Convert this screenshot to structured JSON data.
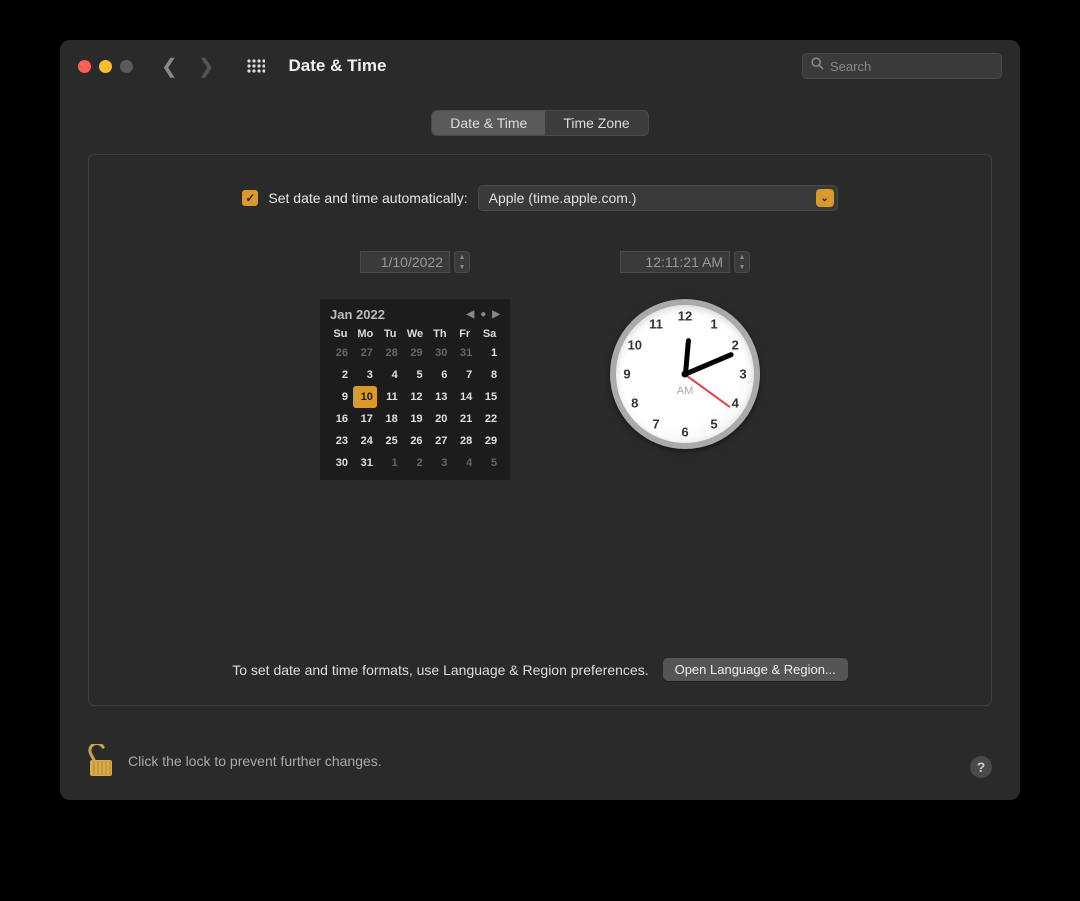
{
  "colors": {
    "close": "#ff5f57",
    "minimize": "#febc2e",
    "zoom": "#5a5a5a",
    "accent": "#d99a2b",
    "checkbox_check": "#2a2a2a"
  },
  "window": {
    "title": "Date & Time"
  },
  "search": {
    "placeholder": "Search",
    "value": ""
  },
  "tabs": [
    {
      "label": "Date & Time",
      "active": true
    },
    {
      "label": "Time Zone",
      "active": false
    }
  ],
  "auto": {
    "checked": true,
    "label": "Set date and time automatically:",
    "server": "Apple (time.apple.com.)"
  },
  "date": {
    "value": "1/10/2022"
  },
  "time": {
    "value": "12:11:21 AM"
  },
  "calendar": {
    "month_label": "Jan 2022",
    "dow": [
      "Su",
      "Mo",
      "Tu",
      "We",
      "Th",
      "Fr",
      "Sa"
    ],
    "weeks": [
      [
        {
          "d": 26,
          "o": true
        },
        {
          "d": 27,
          "o": true
        },
        {
          "d": 28,
          "o": true
        },
        {
          "d": 29,
          "o": true
        },
        {
          "d": 30,
          "o": true
        },
        {
          "d": 31,
          "o": true
        },
        {
          "d": 1
        }
      ],
      [
        {
          "d": 2
        },
        {
          "d": 3
        },
        {
          "d": 4
        },
        {
          "d": 5
        },
        {
          "d": 6
        },
        {
          "d": 7
        },
        {
          "d": 8
        }
      ],
      [
        {
          "d": 9
        },
        {
          "d": 10,
          "sel": true
        },
        {
          "d": 11
        },
        {
          "d": 12
        },
        {
          "d": 13
        },
        {
          "d": 14
        },
        {
          "d": 15
        }
      ],
      [
        {
          "d": 16
        },
        {
          "d": 17
        },
        {
          "d": 18
        },
        {
          "d": 19
        },
        {
          "d": 20
        },
        {
          "d": 21
        },
        {
          "d": 22
        }
      ],
      [
        {
          "d": 23
        },
        {
          "d": 24
        },
        {
          "d": 25
        },
        {
          "d": 26
        },
        {
          "d": 27
        },
        {
          "d": 28
        },
        {
          "d": 29
        }
      ],
      [
        {
          "d": 30
        },
        {
          "d": 31
        },
        {
          "d": 1,
          "o": true
        },
        {
          "d": 2,
          "o": true
        },
        {
          "d": 3,
          "o": true
        },
        {
          "d": 4,
          "o": true
        },
        {
          "d": 5,
          "o": true
        }
      ]
    ]
  },
  "clock": {
    "ampm": "AM",
    "hour_angle": 5,
    "minute_angle": 67,
    "second_angle": 126,
    "numbers": [
      "12",
      "1",
      "2",
      "3",
      "4",
      "5",
      "6",
      "7",
      "8",
      "9",
      "10",
      "11"
    ]
  },
  "formats_hint": "To set date and time formats, use Language & Region preferences.",
  "open_lang_region": "Open Language & Region...",
  "lock": {
    "text": "Click the lock to prevent further changes."
  },
  "help": "?"
}
